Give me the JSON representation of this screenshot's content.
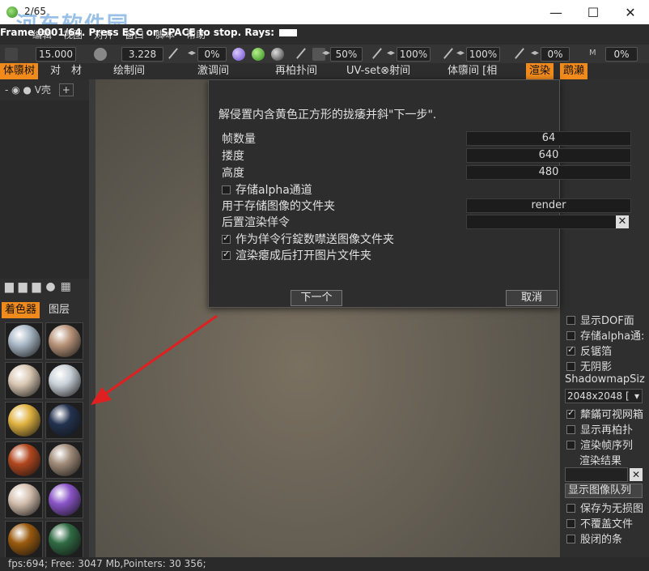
{
  "window": {
    "title": "2/65",
    "watermark": "河东软件园",
    "minimize_glyph": "—",
    "maximize_glyph": "☐",
    "close_glyph": "✕"
  },
  "status_overlay": {
    "text": "Frame 0001/64. Press ESC or SPACE to stop. Rays:",
    "menus": [
      "编辑",
      "视图",
      "对齐",
      "窗口",
      "脚本",
      "帮助"
    ],
    "watermark_url": "www.pc0359.cn"
  },
  "toolbar": {
    "value_1": "15.000",
    "value_2": "3.228",
    "pct_1": "0%",
    "pct_2": "50%",
    "pct_3": "100%",
    "pct_4": "100%",
    "pct_5": "0%",
    "pct_6": "0%",
    "m_label": "M"
  },
  "tabs": [
    {
      "label": "体隳树",
      "active": true
    },
    {
      "label": "对",
      "active": false
    },
    {
      "label": "材",
      "active": false
    },
    {
      "label": "绘制间",
      "active": false
    },
    {
      "label": "激调间",
      "active": false
    },
    {
      "label": "再柏扑间",
      "active": false
    },
    {
      "label": "UV-set⊗射间",
      "active": false
    },
    {
      "label": "体隳间 [相",
      "active": false
    },
    {
      "label": "渲染",
      "active": true
    },
    {
      "label": "鹉濑",
      "active": true
    }
  ],
  "left_panel": {
    "toolbar_text": "- ◉ ● V壳",
    "plus_label": "+",
    "tab_shaders": "着色器",
    "tab_layers": "图层"
  },
  "materials": [
    {
      "name": "material-ball",
      "color": "#a9b8c6"
    },
    {
      "name": "material-ball",
      "color": "#b9947a"
    },
    {
      "name": "material-ball",
      "color": "#d9c7b2"
    },
    {
      "name": "material-ball",
      "color": "#c9d1d8"
    },
    {
      "name": "material-ball",
      "color": "#e0b240"
    },
    {
      "name": "material-ball",
      "color": "#23324f"
    },
    {
      "name": "material-ball",
      "color": "#b2471e"
    },
    {
      "name": "material-ball",
      "color": "#a08b78"
    },
    {
      "name": "material-ball",
      "color": "#d4bfae"
    },
    {
      "name": "material-ball",
      "color": "#8b55c9"
    },
    {
      "name": "material-ball",
      "color": "#9a5a0e"
    },
    {
      "name": "material-ball",
      "color": "#2f6b43"
    }
  ],
  "dialog": {
    "instruction": "解侵置内含黄色正方形的拢痿并斜\"下一步\".",
    "rows": [
      {
        "label": "帧数量",
        "value": "64"
      },
      {
        "label": "搂度",
        "value": "640"
      },
      {
        "label": "高度",
        "value": "480"
      }
    ],
    "store_alpha": "存储alpha通道",
    "folder_label": "用于存储图像的文件夹",
    "folder_value": "render",
    "post_cmd_label": "后置渲染佯令",
    "check_send": "作为佯令行錠数噤送图像文件夹",
    "check_open": "渲染瘪成后打开图片文件夹",
    "next_button": "下一个",
    "cancel_button": "取消"
  },
  "right_panel": {
    "show_dof": "显示DOF面",
    "store_alpha": "存储alpha通:",
    "antialias": "反锯箔",
    "no_shadow": "无阴影",
    "shadowmap_label": "ShadowmapSiz",
    "shadowmap_value": "2048x2048 [",
    "visible_mesh": "犛鏋可视网箱",
    "show_retopo": "显示再柏扑",
    "render_sequence": "渲染帧序列",
    "render_result": "渲染结果",
    "show_queue": "显示图像队列",
    "save_lossless": "保存为无损图",
    "no_overwrite": "不覆盖文件",
    "close_window": "股闭的条"
  },
  "statusbar": {
    "text": "fps:694;  Free: 3047 Mb,Pointers: 30 356;"
  }
}
